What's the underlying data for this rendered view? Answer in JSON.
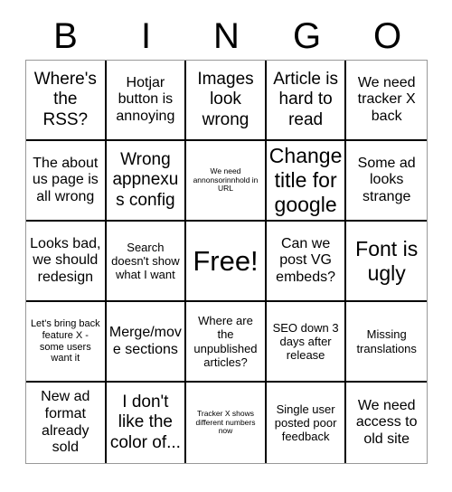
{
  "header": {
    "letters": [
      "B",
      "I",
      "N",
      "G",
      "O"
    ]
  },
  "grid": {
    "rows": 5,
    "columns": 5,
    "cells": [
      {
        "text": "Where's the RSS?",
        "size": "lg"
      },
      {
        "text": "Hotjar button is annoying",
        "size": "md"
      },
      {
        "text": "Images look wrong",
        "size": "lg"
      },
      {
        "text": "Article is hard to read",
        "size": "lg"
      },
      {
        "text": "We need tracker X back",
        "size": "md"
      },
      {
        "text": "The about us page is all wrong",
        "size": "md"
      },
      {
        "text": "Wrong appnexus config",
        "size": "lg"
      },
      {
        "text": "We need annonsorinnhold in URL",
        "size": "xxs"
      },
      {
        "text": "Change title for google",
        "size": "xl"
      },
      {
        "text": "Some ad looks strange",
        "size": "md"
      },
      {
        "text": "Looks bad, we should redesign",
        "size": "md"
      },
      {
        "text": "Search doesn't show what I want",
        "size": "sm"
      },
      {
        "text": "Free!",
        "size": "xxl"
      },
      {
        "text": "Can we post VG embeds?",
        "size": "md"
      },
      {
        "text": "Font is ugly",
        "size": "xl"
      },
      {
        "text": "Let's bring back feature X - some users want it",
        "size": "xs"
      },
      {
        "text": "Merge/move sections",
        "size": "md"
      },
      {
        "text": "Where are the unpublished articles?",
        "size": "sm"
      },
      {
        "text": "SEO down 3 days after release",
        "size": "sm"
      },
      {
        "text": "Missing translations",
        "size": "sm"
      },
      {
        "text": "New ad format already sold",
        "size": "md"
      },
      {
        "text": "I don't like the color of...",
        "size": "lg"
      },
      {
        "text": "Tracker X shows different numbers now",
        "size": "xxs"
      },
      {
        "text": "Single user posted poor feedback",
        "size": "sm"
      },
      {
        "text": "We need access to old site",
        "size": "md"
      }
    ]
  },
  "colors": {
    "background": "#ffffff",
    "text": "#000000",
    "cell_border": "#000000",
    "outer_border": "#999999"
  }
}
